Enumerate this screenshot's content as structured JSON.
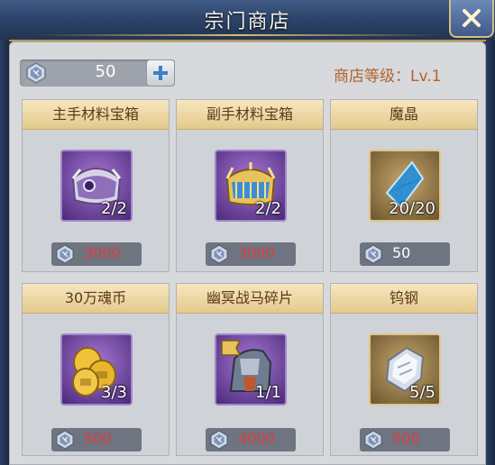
{
  "window": {
    "title": "宗门商店"
  },
  "currency": {
    "amount": "50"
  },
  "shop": {
    "level_label": "商店等级：Lv.1"
  },
  "colors": {
    "price_unaffordable": "#e23b3b",
    "price_affordable": "#ffffff"
  },
  "items": [
    {
      "name": "主手材料宝箱",
      "count": "2/2",
      "price": "3000",
      "affordable": false,
      "icon": "purple-chest-icon"
    },
    {
      "name": "副手材料宝箱",
      "count": "2/2",
      "price": "3000",
      "affordable": false,
      "icon": "gold-chest-icon"
    },
    {
      "name": "魔晶",
      "count": "20/20",
      "price": "50",
      "affordable": true,
      "icon": "blue-crystal-icon"
    },
    {
      "name": "30万魂币",
      "count": "3/3",
      "price": "500",
      "affordable": false,
      "icon": "gold-coins-icon"
    },
    {
      "name": "幽冥战马碎片",
      "count": "1/1",
      "price": "4000",
      "affordable": false,
      "icon": "warhorse-fragment-icon"
    },
    {
      "name": "钨钢",
      "count": "5/5",
      "price": "500",
      "affordable": false,
      "icon": "tungsten-steel-icon"
    }
  ]
}
